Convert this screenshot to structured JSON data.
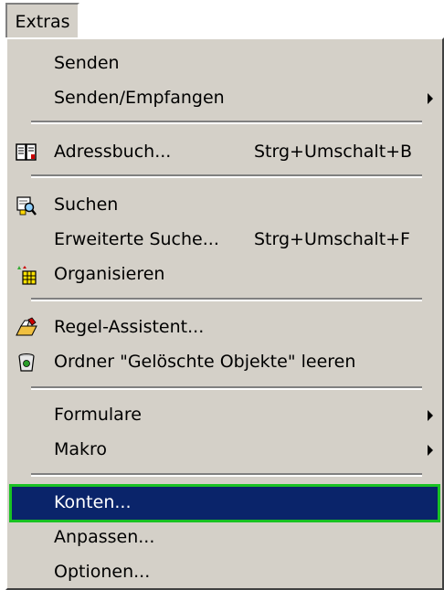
{
  "menubar": {
    "title": "Extras"
  },
  "menu": {
    "items": [
      {
        "label": "Senden"
      },
      {
        "label": "Senden/Empfangen"
      },
      {
        "label": "Adressbuch...",
        "shortcut": "Strg+Umschalt+B",
        "icon": "address-book-icon"
      },
      {
        "label": "Suchen",
        "icon": "search-icon"
      },
      {
        "label": "Erweiterte Suche...",
        "shortcut": "Strg+Umschalt+F"
      },
      {
        "label": "Organisieren",
        "icon": "organize-icon"
      },
      {
        "label": "Regel-Assistent...",
        "icon": "rules-wizard-icon"
      },
      {
        "label": "Ordner \"Gelöschte Objekte\" leeren",
        "icon": "empty-trash-icon"
      },
      {
        "label": "Formulare"
      },
      {
        "label": "Makro"
      },
      {
        "label": "Konten...",
        "selected": true
      },
      {
        "label": "Anpassen..."
      },
      {
        "label": "Optionen..."
      }
    ]
  },
  "colors": {
    "menu_bg": "#d4d0c8",
    "highlight": "#0a246a",
    "highlight_outline": "#19c223"
  }
}
